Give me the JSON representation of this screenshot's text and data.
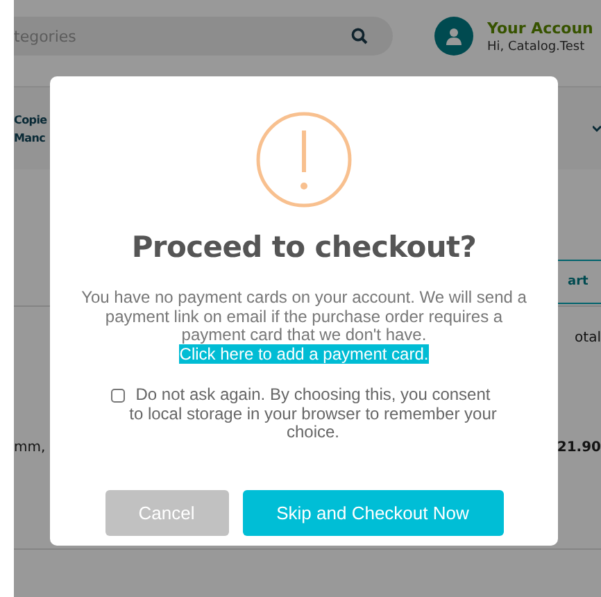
{
  "background": {
    "search": {
      "placeholder": "tegories"
    },
    "account": {
      "title": "Your Accoun",
      "greeting": "Hi, Catalog.Test"
    },
    "product_name": [
      "Copie",
      "Manc"
    ],
    "cart_button": "art",
    "total_label": "otal",
    "product_detail": "mm,",
    "price": "21.90"
  },
  "dialog": {
    "title": "Proceed to checkout?",
    "message": "You have no payment cards on your account. We will send a payment link on email if the purchase order requires a payment card that we don't have.",
    "link": "Click here to add a payment card.",
    "consent": {
      "label": "Do not ask again. By choosing this, you consent to local storage in your browser to remember your choice.",
      "checked": false
    },
    "buttons": [
      {
        "label": "Cancel",
        "kind": "secondary"
      },
      {
        "label": "Skip and Checkout Now",
        "kind": "primary"
      }
    ]
  }
}
